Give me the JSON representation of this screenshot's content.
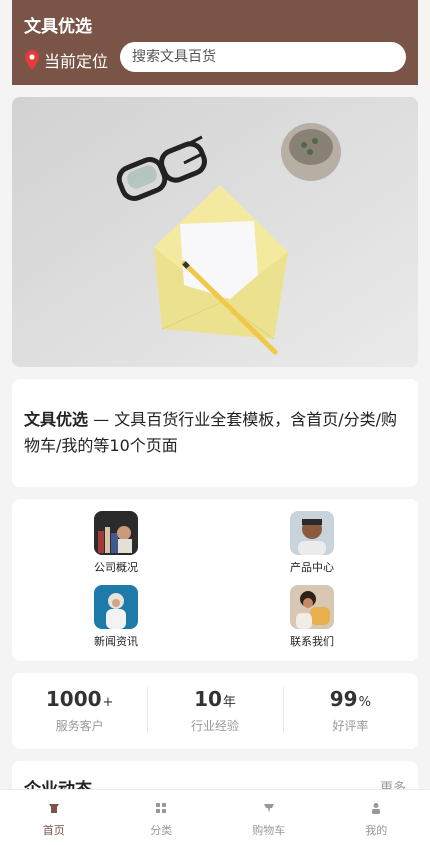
{
  "header": {
    "brand": "文具优选",
    "location_label": "当前定位",
    "search_placeholder": "搜索文具百货"
  },
  "intro": {
    "brand": "文具优选",
    "text": " — 文具百货行业全套模板，含首页/分类/购物车/我的等10个页面"
  },
  "nav": [
    {
      "label": "公司概况"
    },
    {
      "label": "产品中心"
    },
    {
      "label": "新闻资讯"
    },
    {
      "label": "联系我们"
    }
  ],
  "stats": [
    {
      "value": "1000",
      "unit": "+",
      "caption": "服务客户"
    },
    {
      "value": "10",
      "unit": "年",
      "caption": "行业经验"
    },
    {
      "value": "99",
      "unit": "%",
      "caption": "好评率"
    }
  ],
  "news": {
    "title": "企业动态",
    "more": "更多"
  },
  "tabbar": [
    {
      "label": "首页",
      "icon": "home-icon",
      "active": true
    },
    {
      "label": "分类",
      "icon": "grid-icon",
      "active": false
    },
    {
      "label": "购物车",
      "icon": "cart-icon",
      "active": false
    },
    {
      "label": "我的",
      "icon": "user-icon",
      "active": false
    }
  ],
  "colors": {
    "brand": "#7a5446",
    "background": "#f4f4f4"
  }
}
